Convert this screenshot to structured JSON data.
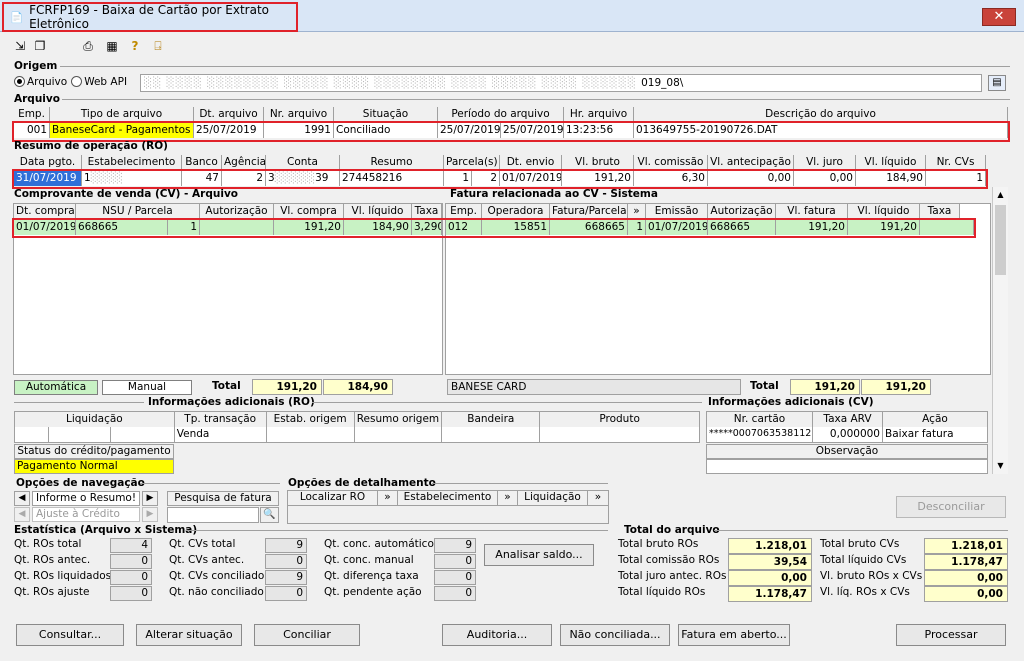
{
  "window": {
    "title": "FCRFP169 - Baixa de Cartão por Extrato Eletrônico"
  },
  "origem": {
    "label": "Origem",
    "opt_arquivo": "Arquivo",
    "opt_webapi": "Web API",
    "path": "019_08\\"
  },
  "arquivo": {
    "label": "Arquivo",
    "headers": [
      "Emp.",
      "Tipo de arquivo",
      "Dt. arquivo",
      "Nr. arquivo",
      "Situação",
      "Período do arquivo",
      "Hr. arquivo",
      "Descrição do arquivo"
    ],
    "row": {
      "emp": "001",
      "tipo": "BaneseCard - Pagamentos",
      "dt": "25/07/2019",
      "nr": "1991",
      "situacao": "Conciliado",
      "periodo_ini": "25/07/2019",
      "periodo_fim": "25/07/2019",
      "hr": "13:23:56",
      "descricao": "013649755-20190726.DAT"
    }
  },
  "ro": {
    "label": "Resumo de operação (RO)",
    "headers": [
      "Data pgto.",
      "Estabelecimento",
      "Banco",
      "Agência",
      "Conta",
      "Resumo",
      "Parcela(s)",
      "Dt. envio",
      "Vl. bruto",
      "Vl. comissão",
      "Vl. antecipação",
      "Vl. juro",
      "Vl. líquido",
      "Nr. CVs"
    ],
    "row": {
      "data": "31/07/2019",
      "estab": "1",
      "banco": "47",
      "agencia": "2",
      "conta": "3",
      "conta_end": "39",
      "resumo": "274458216",
      "parc_a": "1",
      "parc_b": "2",
      "dt_envio": "01/07/2019",
      "bruto": "191,20",
      "comissao": "6,30",
      "antecip": "0,00",
      "juro": "0,00",
      "liquido": "184,90",
      "ncvs": "1"
    }
  },
  "cv": {
    "label": "Comprovante de venda (CV) - Arquivo",
    "headers": [
      "Dt. compra",
      "NSU / Parcela",
      "Autorização",
      "Vl. compra",
      "Vl. líquido",
      "Taxa"
    ],
    "row": {
      "dt": "01/07/2019",
      "nsu": "668665",
      "parcela": "1",
      "autorizacao": "",
      "compra": "191,20",
      "liquido": "184,90",
      "taxa": "3,2900"
    },
    "leg_auto": "Automática",
    "leg_manual": "Manual",
    "total_label": "Total",
    "total_compra": "191,20",
    "total_liquido": "184,90"
  },
  "fatura": {
    "label": "Fatura relacionada ao CV - Sistema",
    "headers": [
      "Emp.",
      "Operadora",
      "Fatura/Parcela",
      "»",
      "Emissão",
      "Autorização",
      "Vl. fatura",
      "Vl. líquido",
      "Taxa"
    ],
    "row": {
      "emp": "012",
      "operadora": "15851",
      "fatura": "668665",
      "parcela": "1",
      "emissao": "01/07/2019",
      "autorizacao": "668665",
      "vlfatura": "191,20",
      "liquido": "191,20",
      "taxa": ""
    },
    "operadora_nome": "BANESE CARD",
    "total_label": "Total",
    "total_fatura": "191,20",
    "total_liquido": "191,20"
  },
  "info_ro": {
    "label": "Informações adicionais (RO)",
    "headers": [
      "Liquidação",
      "Tp. transação",
      "Estab. origem",
      "Resumo origem",
      "Bandeira",
      "Produto"
    ],
    "tp_transacao": "Venda",
    "status_label": "Status do crédito/pagamento",
    "status_value": "Pagamento Normal"
  },
  "info_cv": {
    "label": "Informações adicionais (CV)",
    "headers": [
      "Nr. cartão",
      "Taxa ARV",
      "Ação"
    ],
    "cartao": "*****0007063538112",
    "taxa_arv": "0,000000",
    "acao": "Baixar fatura",
    "obs_label": "Observação"
  },
  "nav": {
    "label": "Opções de navegação",
    "item1": "Informe o Resumo!",
    "item2": "Ajuste à Crédito",
    "pesquisa": "Pesquisa de fatura"
  },
  "detalhe": {
    "label": "Opções de detalhamento",
    "localizar": "Localizar RO",
    "estab": "Estabelecimento",
    "liquidacao": "Liquidação"
  },
  "desconciliar": "Desconciliar",
  "estat": {
    "label": "Estatística (Arquivo x Sistema)",
    "col1": [
      {
        "l": "Qt. ROs total",
        "v": "4"
      },
      {
        "l": "Qt. ROs antec.",
        "v": "0"
      },
      {
        "l": "Qt. ROs liquidados",
        "v": "0"
      },
      {
        "l": "Qt. ROs ajuste",
        "v": "0"
      }
    ],
    "col2": [
      {
        "l": "Qt. CVs total",
        "v": "9"
      },
      {
        "l": "Qt. CVs antec.",
        "v": "0"
      },
      {
        "l": "Qt. CVs conciliado",
        "v": "9"
      },
      {
        "l": "Qt. não conciliado",
        "v": "0"
      }
    ],
    "col3": [
      {
        "l": "Qt. conc. automático",
        "v": "9"
      },
      {
        "l": "Qt. conc. manual",
        "v": "0"
      },
      {
        "l": "Qt. diferença taxa",
        "v": "0"
      },
      {
        "l": "Qt. pendente ação",
        "v": "0"
      }
    ],
    "analisar": "Analisar saldo..."
  },
  "total_arquivo": {
    "label": "Total do arquivo",
    "left": [
      {
        "l": "Total bruto ROs",
        "v": "1.218,01"
      },
      {
        "l": "Total comissão ROs",
        "v": "39,54"
      },
      {
        "l": "Total juro antec. ROs",
        "v": "0,00"
      },
      {
        "l": "Total líquido ROs",
        "v": "1.178,47"
      }
    ],
    "right": [
      {
        "l": "Total bruto CVs",
        "v": "1.218,01"
      },
      {
        "l": "Total líquido CVs",
        "v": "1.178,47"
      },
      {
        "l": "Vl. bruto ROs x CVs",
        "v": "0,00"
      },
      {
        "l": "Vl. líq. ROs x CVs",
        "v": "0,00"
      }
    ]
  },
  "buttons": {
    "consultar": "Consultar...",
    "alterar": "Alterar situação",
    "conciliar": "Conciliar",
    "auditoria": "Auditoria...",
    "nao_conciliada": "Não conciliada...",
    "fatura_aberto": "Fatura em aberto...",
    "processar": "Processar"
  },
  "colors": {
    "highlight_red": "#e0222a",
    "conciliado_green": "#c8f2c4",
    "yellow": "#ffff00",
    "selected_blue": "#2f6fd8"
  }
}
